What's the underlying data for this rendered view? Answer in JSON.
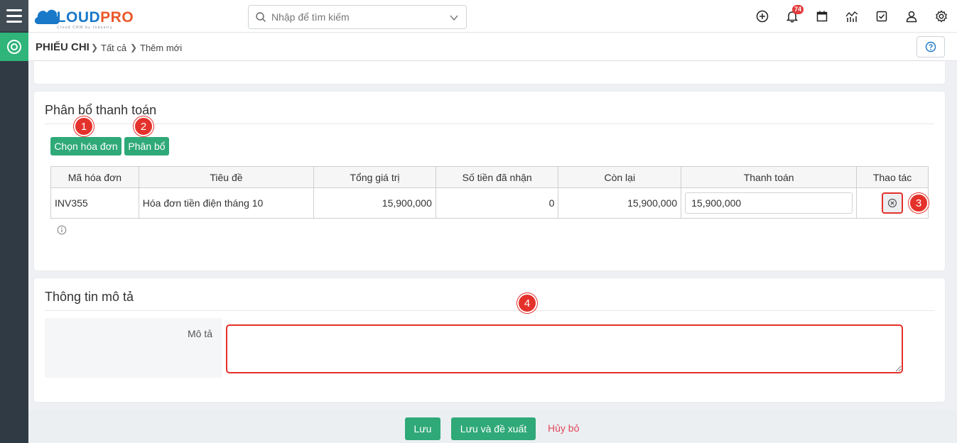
{
  "brand": {
    "name_part1": "CLOUD",
    "name_part2": "PRO",
    "tagline": "Cloud CRM by Industry",
    "color_primary": "#1a78c8",
    "color_accent": "#e9582a"
  },
  "header": {
    "search_placeholder": "Nhập để tìm kiếm",
    "notification_count": "74",
    "icons": [
      "plus-circle-icon",
      "bell-icon",
      "calendar-icon",
      "chart-icon",
      "checkbox-icon",
      "user-icon",
      "gear-icon"
    ]
  },
  "breadcrumb": {
    "module": "PHIẾU CHI",
    "items": [
      "Tất cả",
      "Thêm mới"
    ]
  },
  "payment_allocation": {
    "title": "Phân bổ thanh toán",
    "buttons": {
      "choose_invoice": "Chọn hóa đơn",
      "allocate": "Phân bổ"
    },
    "columns": [
      "Mã hóa đơn",
      "Tiêu đề",
      "Tổng giá trị",
      "Số tiền đã nhận",
      "Còn lại",
      "Thanh toán",
      "Thao tác"
    ],
    "rows": [
      {
        "invoice_code": "INV355",
        "title": "Hóa đơn tiền điện tháng 10",
        "total": "15,900,000",
        "received": "0",
        "remaining": "15,900,000",
        "payment": "15,900,000"
      }
    ]
  },
  "description": {
    "title": "Thông tin mô tả",
    "label": "Mô tả",
    "value": ""
  },
  "markers": [
    "1",
    "2",
    "3",
    "4"
  ],
  "footer": {
    "save": "Lưu",
    "save_and_propose": "Lưu và đề xuất",
    "cancel": "Hủy bỏ"
  },
  "colors": {
    "success": "#2fa978",
    "sidebar": "#2f3a44",
    "module_active": "#2fb47a",
    "marker": "#e4312b",
    "cancel": "#e0475a"
  }
}
